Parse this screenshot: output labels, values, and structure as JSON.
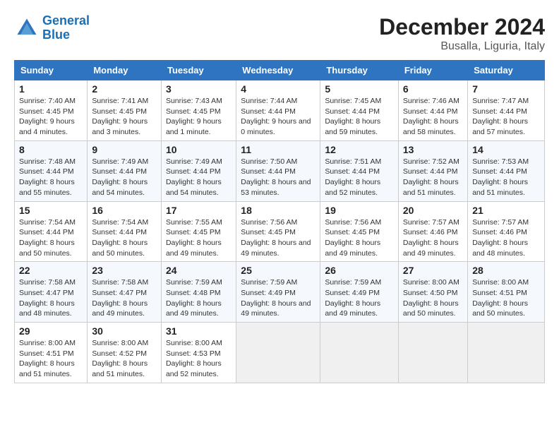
{
  "header": {
    "logo_line1": "General",
    "logo_line2": "Blue",
    "month": "December 2024",
    "location": "Busalla, Liguria, Italy"
  },
  "weekdays": [
    "Sunday",
    "Monday",
    "Tuesday",
    "Wednesday",
    "Thursday",
    "Friday",
    "Saturday"
  ],
  "weeks": [
    [
      {
        "day": 1,
        "sunrise": "7:40 AM",
        "sunset": "4:45 PM",
        "daylight": "9 hours and 4 minutes."
      },
      {
        "day": 2,
        "sunrise": "7:41 AM",
        "sunset": "4:45 PM",
        "daylight": "9 hours and 3 minutes."
      },
      {
        "day": 3,
        "sunrise": "7:43 AM",
        "sunset": "4:45 PM",
        "daylight": "9 hours and 1 minute."
      },
      {
        "day": 4,
        "sunrise": "7:44 AM",
        "sunset": "4:44 PM",
        "daylight": "9 hours and 0 minutes."
      },
      {
        "day": 5,
        "sunrise": "7:45 AM",
        "sunset": "4:44 PM",
        "daylight": "8 hours and 59 minutes."
      },
      {
        "day": 6,
        "sunrise": "7:46 AM",
        "sunset": "4:44 PM",
        "daylight": "8 hours and 58 minutes."
      },
      {
        "day": 7,
        "sunrise": "7:47 AM",
        "sunset": "4:44 PM",
        "daylight": "8 hours and 57 minutes."
      }
    ],
    [
      {
        "day": 8,
        "sunrise": "7:48 AM",
        "sunset": "4:44 PM",
        "daylight": "8 hours and 55 minutes."
      },
      {
        "day": 9,
        "sunrise": "7:49 AM",
        "sunset": "4:44 PM",
        "daylight": "8 hours and 54 minutes."
      },
      {
        "day": 10,
        "sunrise": "7:49 AM",
        "sunset": "4:44 PM",
        "daylight": "8 hours and 54 minutes."
      },
      {
        "day": 11,
        "sunrise": "7:50 AM",
        "sunset": "4:44 PM",
        "daylight": "8 hours and 53 minutes."
      },
      {
        "day": 12,
        "sunrise": "7:51 AM",
        "sunset": "4:44 PM",
        "daylight": "8 hours and 52 minutes."
      },
      {
        "day": 13,
        "sunrise": "7:52 AM",
        "sunset": "4:44 PM",
        "daylight": "8 hours and 51 minutes."
      },
      {
        "day": 14,
        "sunrise": "7:53 AM",
        "sunset": "4:44 PM",
        "daylight": "8 hours and 51 minutes."
      }
    ],
    [
      {
        "day": 15,
        "sunrise": "7:54 AM",
        "sunset": "4:44 PM",
        "daylight": "8 hours and 50 minutes."
      },
      {
        "day": 16,
        "sunrise": "7:54 AM",
        "sunset": "4:44 PM",
        "daylight": "8 hours and 50 minutes."
      },
      {
        "day": 17,
        "sunrise": "7:55 AM",
        "sunset": "4:45 PM",
        "daylight": "8 hours and 49 minutes."
      },
      {
        "day": 18,
        "sunrise": "7:56 AM",
        "sunset": "4:45 PM",
        "daylight": "8 hours and 49 minutes."
      },
      {
        "day": 19,
        "sunrise": "7:56 AM",
        "sunset": "4:45 PM",
        "daylight": "8 hours and 49 minutes."
      },
      {
        "day": 20,
        "sunrise": "7:57 AM",
        "sunset": "4:46 PM",
        "daylight": "8 hours and 49 minutes."
      },
      {
        "day": 21,
        "sunrise": "7:57 AM",
        "sunset": "4:46 PM",
        "daylight": "8 hours and 48 minutes."
      }
    ],
    [
      {
        "day": 22,
        "sunrise": "7:58 AM",
        "sunset": "4:47 PM",
        "daylight": "8 hours and 48 minutes."
      },
      {
        "day": 23,
        "sunrise": "7:58 AM",
        "sunset": "4:47 PM",
        "daylight": "8 hours and 49 minutes."
      },
      {
        "day": 24,
        "sunrise": "7:59 AM",
        "sunset": "4:48 PM",
        "daylight": "8 hours and 49 minutes."
      },
      {
        "day": 25,
        "sunrise": "7:59 AM",
        "sunset": "4:49 PM",
        "daylight": "8 hours and 49 minutes."
      },
      {
        "day": 26,
        "sunrise": "7:59 AM",
        "sunset": "4:49 PM",
        "daylight": "8 hours and 49 minutes."
      },
      {
        "day": 27,
        "sunrise": "8:00 AM",
        "sunset": "4:50 PM",
        "daylight": "8 hours and 50 minutes."
      },
      {
        "day": 28,
        "sunrise": "8:00 AM",
        "sunset": "4:51 PM",
        "daylight": "8 hours and 50 minutes."
      }
    ],
    [
      {
        "day": 29,
        "sunrise": "8:00 AM",
        "sunset": "4:51 PM",
        "daylight": "8 hours and 51 minutes."
      },
      {
        "day": 30,
        "sunrise": "8:00 AM",
        "sunset": "4:52 PM",
        "daylight": "8 hours and 51 minutes."
      },
      {
        "day": 31,
        "sunrise": "8:00 AM",
        "sunset": "4:53 PM",
        "daylight": "8 hours and 52 minutes."
      },
      null,
      null,
      null,
      null
    ]
  ]
}
